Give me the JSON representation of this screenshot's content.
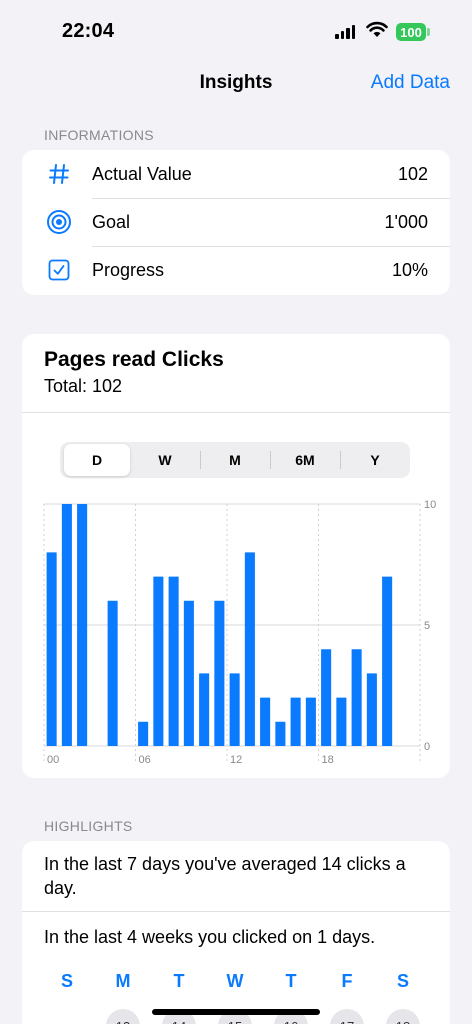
{
  "status": {
    "time": "22:04",
    "battery": "100"
  },
  "nav": {
    "title": "Insights",
    "action": "Add Data"
  },
  "info": {
    "header": "INFORMATIONS",
    "rows": [
      {
        "icon": "hash-icon",
        "label": "Actual Value",
        "value": "102"
      },
      {
        "icon": "target-icon",
        "label": "Goal",
        "value": "1'000"
      },
      {
        "icon": "checkbox-icon",
        "label": "Progress",
        "value": "10%"
      }
    ]
  },
  "chart_card": {
    "title": "Pages read Clicks",
    "subtitle": "Total: 102",
    "segments": [
      "D",
      "W",
      "M",
      "6M",
      "Y"
    ],
    "selected_segment": "D"
  },
  "chart_data": {
    "type": "bar",
    "x": [
      0,
      1,
      2,
      3,
      4,
      5,
      6,
      7,
      8,
      9,
      10,
      11,
      12,
      13,
      14,
      15,
      16,
      17,
      18,
      19,
      20,
      21,
      22,
      23
    ],
    "values": [
      8,
      10,
      10,
      0,
      6,
      0,
      1,
      7,
      7,
      6,
      3,
      6,
      3,
      8,
      2,
      1,
      2,
      2,
      4,
      2,
      4,
      3,
      7,
      0
    ],
    "x_tick_labels": [
      "00",
      "06",
      "12",
      "18"
    ],
    "y_tick_labels": [
      "10",
      "5",
      "0"
    ],
    "ylim": [
      0,
      10
    ],
    "color": "#0a7aff",
    "grid": true
  },
  "highlights": {
    "header": "HIGHLIGHTS",
    "line1": "In the last 7 days you've averaged 14 clicks a day.",
    "line2": "In the last 4 weeks you clicked on 1 days.",
    "weekdays": [
      "S",
      "M",
      "T",
      "W",
      "T",
      "F",
      "S"
    ],
    "dates": [
      "13",
      "14",
      "15",
      "16",
      "17",
      "18"
    ]
  },
  "colors": {
    "accent": "#0a7aff",
    "background": "#f2f2f7",
    "battery": "#34c759"
  }
}
